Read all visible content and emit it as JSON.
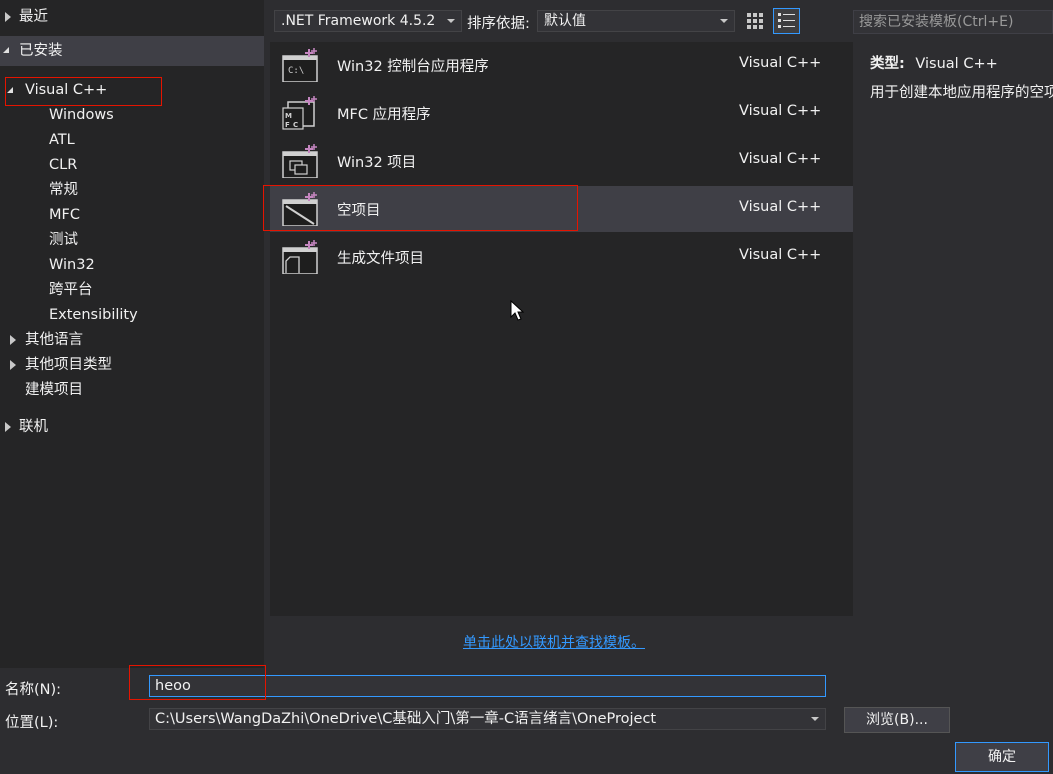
{
  "tree": {
    "recent": "最近",
    "installed": "已安装",
    "visual_cpp": "Visual C++",
    "children": [
      "Windows",
      "ATL",
      "CLR",
      "常规",
      "MFC",
      "测试",
      "Win32",
      "跨平台",
      "Extensibility"
    ],
    "other_languages": "其他语言",
    "other_project_types": "其他项目类型",
    "modeling_projects": "建模项目",
    "online": "联机"
  },
  "toolbar": {
    "framework": ".NET Framework 4.5.2",
    "sort_label": "排序依据:",
    "sort_value": "默认值"
  },
  "search": {
    "placeholder": "搜索已安装模板(Ctrl+E)"
  },
  "templates": [
    {
      "name": "Win32 控制台应用程序",
      "lang": "Visual C++",
      "icon": "console-app-icon"
    },
    {
      "name": "MFC 应用程序",
      "lang": "Visual C++",
      "icon": "mfc-app-icon"
    },
    {
      "name": "Win32 项目",
      "lang": "Visual C++",
      "icon": "win32-project-icon"
    },
    {
      "name": "空项目",
      "lang": "Visual C++",
      "icon": "empty-project-icon"
    },
    {
      "name": "生成文件项目",
      "lang": "Visual C++",
      "icon": "makefile-project-icon"
    }
  ],
  "details": {
    "type_label": "类型:",
    "type_value": "Visual C++",
    "description": "用于创建本地应用程序的空项"
  },
  "online_link": "单击此处以联机并查找模板。",
  "form": {
    "name_label": "名称(N):",
    "name_value": "heoo",
    "location_label": "位置(L):",
    "location_value": "C:\\Users\\WangDaZhi\\OneDrive\\C基础入门\\第一章-C语言绪言\\OneProject",
    "browse_label": "浏览(B)...",
    "ok_label": "确定"
  },
  "colors": {
    "accent": "#3399ff",
    "highlight_box": "#e51400",
    "background": "#2d2d30"
  }
}
